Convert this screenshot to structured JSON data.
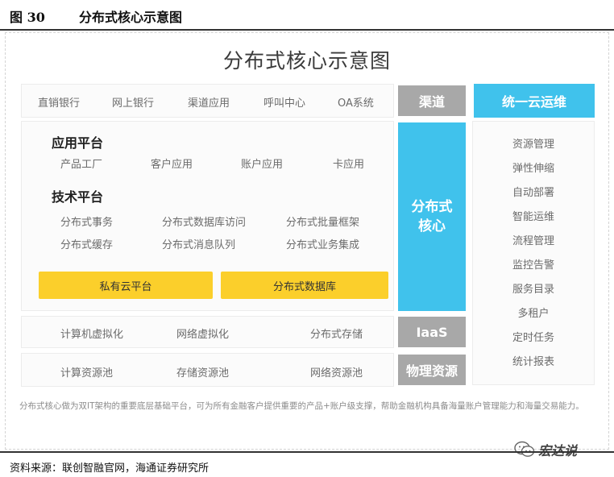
{
  "figure": {
    "number": "图 30",
    "caption": "分布式核心示意图"
  },
  "diagram": {
    "title": "分布式核心示意图",
    "channels": {
      "items": [
        "直销银行",
        "网上银行",
        "渠道应用",
        "呼叫中心",
        "OA系统"
      ],
      "label": "渠道"
    },
    "app_platform": {
      "title": "应用平台",
      "items": [
        "产品工厂",
        "客户应用",
        "账户应用",
        "卡应用"
      ]
    },
    "tech_platform": {
      "title": "技术平台",
      "items": [
        "分布式事务",
        "分布式数据库访问",
        "分布式批量框架",
        "分布式缓存",
        "分布式消息队列",
        "分布式业务集成"
      ]
    },
    "yellow_blocks": [
      "私有云平台",
      "分布式数据库"
    ],
    "core_label": "分布式核心",
    "iaas": {
      "items": [
        "计算机虚拟化",
        "网络虚拟化",
        "分布式存储"
      ],
      "label": "IaaS"
    },
    "physical": {
      "items": [
        "计算资源池",
        "存储资源池",
        "网络资源池"
      ],
      "label": "物理资源"
    },
    "ops": {
      "title": "统一云运维",
      "items": [
        "资源管理",
        "弹性伸缩",
        "自动部署",
        "智能运维",
        "流程管理",
        "监控告警",
        "服务目录",
        "多租户",
        "定时任务",
        "统计报表"
      ]
    },
    "note": "分布式核心做为双IT架构的重要底层基础平台，可为所有金融客户提供重要的产品+账户级支撑，帮助金融机构具备海量账户管理能力和海量交易能力。",
    "colors": {
      "blue": "#40c2ec",
      "gray": "#a8a8a8",
      "yellow": "#fbcf2b"
    }
  },
  "source": "资料来源：联创智融官网，海通证券研究所",
  "watermark": "宏达说"
}
